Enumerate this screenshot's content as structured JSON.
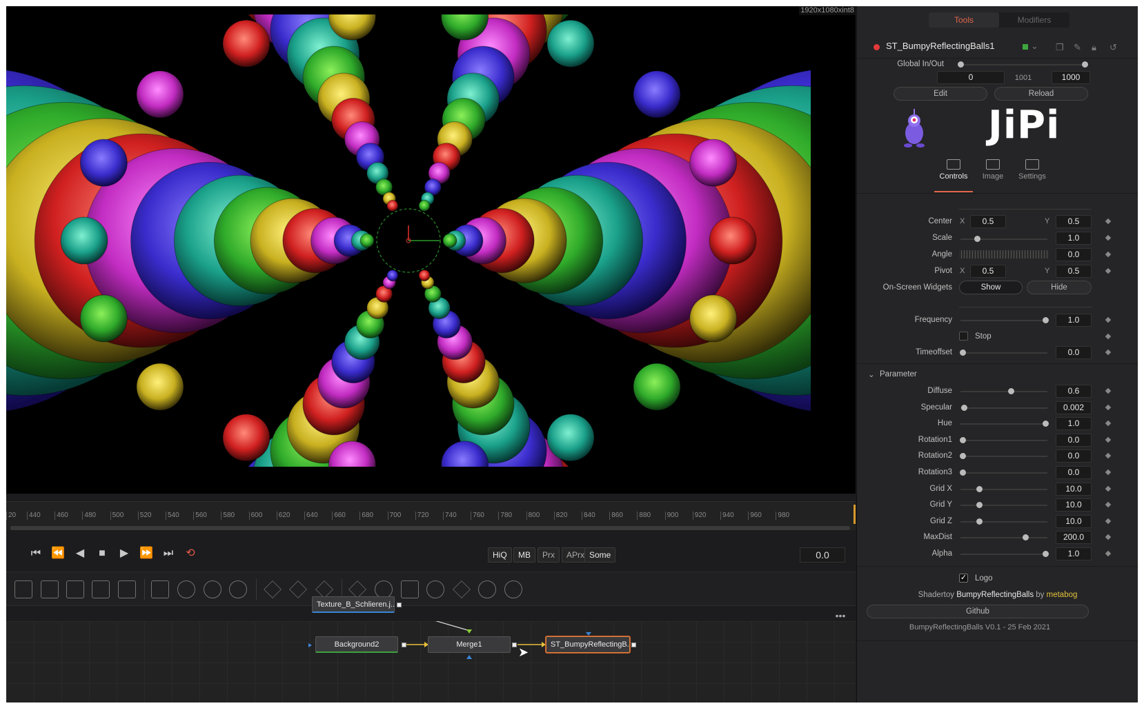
{
  "viewer": {
    "resolution": "1920x1080xint8"
  },
  "timeline": {
    "ticks": [
      "20",
      "440",
      "460",
      "480",
      "500",
      "520",
      "540",
      "560",
      "580",
      "600",
      "620",
      "640",
      "660",
      "680",
      "700",
      "720",
      "740",
      "760",
      "780",
      "800",
      "820",
      "840",
      "860",
      "880",
      "900",
      "920",
      "940",
      "960",
      "980"
    ]
  },
  "transport": {
    "buttons": [
      {
        "name": "go-to-start",
        "glyph": "⏮"
      },
      {
        "name": "step-back",
        "glyph": "⏪"
      },
      {
        "name": "play-reverse",
        "glyph": "◀"
      },
      {
        "name": "stop",
        "glyph": "■"
      },
      {
        "name": "play",
        "glyph": "▶"
      },
      {
        "name": "step-forward",
        "glyph": "⏩"
      },
      {
        "name": "go-to-end",
        "glyph": "⏭"
      },
      {
        "name": "loop",
        "glyph": "⟲"
      }
    ],
    "modes": [
      {
        "label": "HiQ",
        "on": true
      },
      {
        "label": "MB",
        "on": true
      },
      {
        "label": "Prx",
        "on": false
      },
      {
        "label": "APrx",
        "on": false
      },
      {
        "label": "Some",
        "on": true
      }
    ],
    "timecode": "0.0"
  },
  "flow": {
    "ellipsis": "•••",
    "nodes": {
      "texture": "Texture_B_Schlieren.j...",
      "background": "Background2",
      "merge": "Merge1",
      "shader": "ST_BumpyReflectingB..."
    }
  },
  "inspector": {
    "tabs": {
      "tools": "Tools",
      "modifiers": "Modifiers"
    },
    "tool_name": "ST_BumpyReflectingBalls1",
    "global_inout": {
      "label": "Global In/Out",
      "in": "0",
      "mid": "1001",
      "out": "1000"
    },
    "edit": "Edit",
    "reload": "Reload",
    "logo": "JiPi",
    "panel_tabs": {
      "controls": "Controls",
      "image": "Image",
      "settings": "Settings"
    },
    "center": {
      "label": "Center",
      "x_label": "X",
      "x": "0.5",
      "y_label": "Y",
      "y": "0.5"
    },
    "scale": {
      "label": "Scale",
      "value": "1.0"
    },
    "angle": {
      "label": "Angle",
      "value": "0.0"
    },
    "pivot": {
      "label": "Pivot",
      "x_label": "X",
      "x": "0.5",
      "y_label": "Y",
      "y": "0.5"
    },
    "widgets": {
      "label": "On-Screen Widgets",
      "show": "Show",
      "hide": "Hide"
    },
    "frequency": {
      "label": "Frequency",
      "value": "1.0"
    },
    "stop": {
      "label": "Stop"
    },
    "timeoffset": {
      "label": "Timeoffset",
      "value": "0.0"
    },
    "parameter": {
      "label": "Parameter",
      "rows": [
        {
          "label": "Diffuse",
          "value": "0.6"
        },
        {
          "label": "Specular",
          "value": "0.002"
        },
        {
          "label": "Hue",
          "value": "1.0"
        },
        {
          "label": "Rotation1",
          "value": "0.0"
        },
        {
          "label": "Rotation2",
          "value": "0.0"
        },
        {
          "label": "Rotation3",
          "value": "0.0"
        },
        {
          "label": "Grid X",
          "value": "10.0"
        },
        {
          "label": "Grid Y",
          "value": "10.0"
        },
        {
          "label": "Grid Z",
          "value": "10.0"
        },
        {
          "label": "MaxDist",
          "value": "200.0"
        },
        {
          "label": "Alpha",
          "value": "1.0"
        }
      ]
    },
    "logo_check": {
      "label": "Logo",
      "checked": "✓"
    },
    "credit": {
      "prefix": "Shadertoy",
      "shader": "BumpyReflectingBalls",
      "by": "by",
      "author": "metabog"
    },
    "github": "Github",
    "version": "BumpyReflectingBalls V0.1 - 25 Feb 2021"
  }
}
